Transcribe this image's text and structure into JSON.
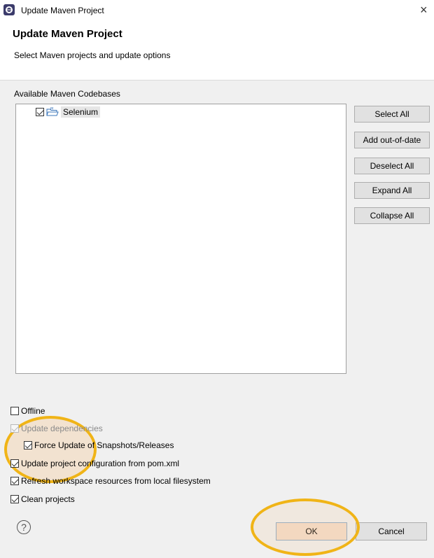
{
  "window": {
    "title": "Update Maven Project",
    "close_glyph": "×"
  },
  "banner": {
    "title": "Update Maven Project",
    "subtitle": "Select Maven projects and update options"
  },
  "codebases": {
    "label": "Available Maven Codebases",
    "items": [
      {
        "label": "Selenium",
        "checked": true,
        "icon": "maven-project-folder-icon"
      }
    ]
  },
  "side_buttons": {
    "select_all": "Select All",
    "add_out_of_date": "Add out-of-date",
    "deselect_all": "Deselect All",
    "expand_all": "Expand All",
    "collapse_all": "Collapse All"
  },
  "options": {
    "offline": {
      "label": "Offline",
      "checked": false
    },
    "update_dependencies": {
      "label": "Update dependencies",
      "checked": true,
      "disabled": true
    },
    "force_update": {
      "label": "Force Update of Snapshots/Releases",
      "checked": true
    },
    "update_config": {
      "label": "Update project configuration from pom.xml",
      "checked": true
    },
    "refresh_workspace": {
      "label": "Refresh workspace resources from local filesystem",
      "checked": true
    },
    "clean_projects": {
      "label": "Clean projects",
      "checked": true
    }
  },
  "footer": {
    "help_glyph": "?",
    "ok_label": "OK",
    "cancel_label": "Cancel"
  },
  "colors": {
    "highlight_ring": "#f0b417",
    "ok_button_bg": "#f3dcca"
  }
}
